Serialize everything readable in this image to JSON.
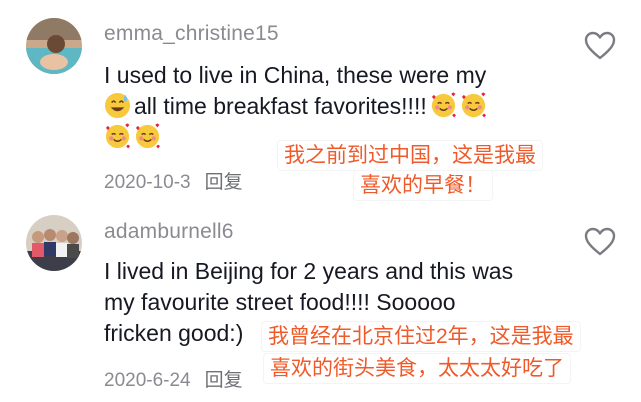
{
  "comments": [
    {
      "username": "emma_christine15",
      "text_line1": "I used to live in China, these were my",
      "text_line2": "all time breakfast favorites!!!!",
      "date": "2020-10-3",
      "reply_label": "回复",
      "translation_line1": "我之前到过中国，这是我最",
      "translation_line2": "喜欢的早餐！",
      "icons": [
        "grinning-sweat-emoji",
        "smiling-hearts-emoji",
        "heart-outline-icon"
      ]
    },
    {
      "username": "adamburnell6",
      "text_line1": "I lived in Beijing for 2 years and this was",
      "text_line2": "my favourite street food!!!! Sooooo",
      "text_line3": "fricken good:)",
      "date": "2020-6-24",
      "reply_label": "回复",
      "translation_line1": "我曾经在北京住过2年，这是我最",
      "translation_line2": "喜欢的街头美食，太太太好吃了",
      "icons": [
        "heart-outline-icon"
      ]
    }
  ],
  "colors": {
    "username": "#8a8b91",
    "text": "#161823",
    "translation": "#f05a2a"
  }
}
